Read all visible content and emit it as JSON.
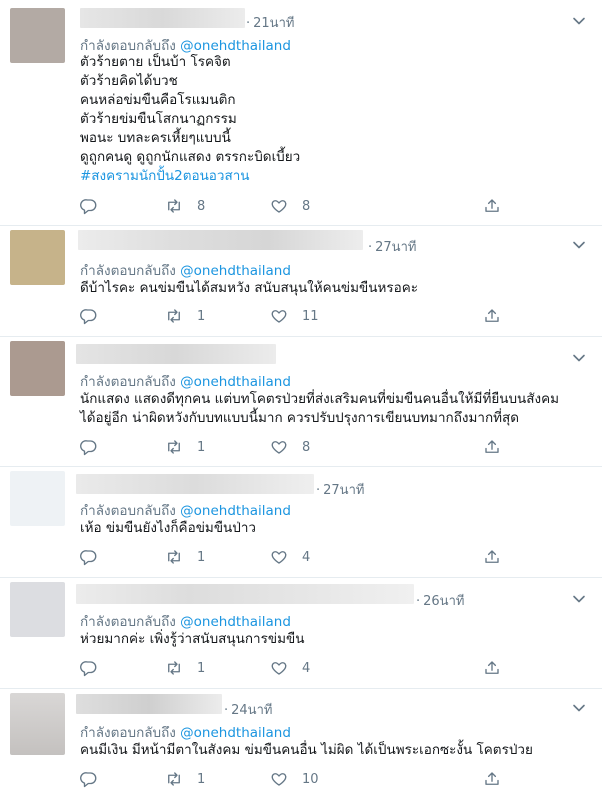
{
  "reply_prefix": "กำลังตอบกลับถึง",
  "handle": "@onehdthailand",
  "tweets": [
    {
      "time": "21นาที",
      "lines": [
        "ตัวร้ายตาย เป็นบ้า โรคจิต",
        "ตัวร้ายคิดได้บวช",
        "คนหล่อข่มขืนคือโรแมนติก",
        "ตัวร้ายข่มขืนโสกนาฏกรรม",
        "พอนะ บทละครเหี้ยๆแบบนี้",
        "ดูถูกคนดู ดูถูกนักแสดง ตรรกะบิดเบี้ยว"
      ],
      "hashtag": "#สงครามนักปั้น2ตอนอวสาน",
      "replies": "",
      "retweets": "8",
      "likes": "8",
      "avatar_color": "#b3aaa4"
    },
    {
      "time": "27นาที",
      "lines": [
        "ดีบ้าไรคะ คนข่มขืนได้สมหวัง สนับสนุนให้คนข่มขืนหรอคะ"
      ],
      "hashtag": "",
      "replies": "",
      "retweets": "1",
      "likes": "11",
      "avatar_color": "#c6b38a"
    },
    {
      "time": "",
      "lines": [
        "นักแสดง แสดงดีทุกคน แต่บทโคตรป่วยที่ส่งเสริมคนที่ข่มขืนคนอื่นให้มีที่ยืนบนสังคม",
        "ได้อยู่อีก น่าผิดหวังกับบทแบบนี้มาก ควรปรับปรุงการเขียนบทมากถึงมากที่สุด"
      ],
      "hashtag": "",
      "replies": "",
      "retweets": "1",
      "likes": "8",
      "avatar_color": "#ab9a90"
    },
    {
      "time": "27นาที",
      "lines": [
        "เห้อ ข่มขืนยังไงก็คือข่มขืนป่าว"
      ],
      "hashtag": "",
      "replies": "",
      "retweets": "1",
      "likes": "4",
      "avatar_color": "#eef2f5"
    },
    {
      "time": "26นาที",
      "lines": [
        "ห่วยมากค่ะ เพิ่งรู้ว่าสนับสนุนการข่มขืน"
      ],
      "hashtag": "",
      "replies": "",
      "retweets": "1",
      "likes": "4",
      "avatar_color": "#dcdde1"
    },
    {
      "time": "24นาที",
      "lines": [
        "คนมีเงิน มีหน้ามีตาในสังคม ข่มขืนคนอื่น ไม่ผิด ได้เป็นพระเอกซะงั้น โคตรป่วย"
      ],
      "hashtag": "",
      "replies": "",
      "retweets": "1",
      "likes": "10",
      "avatar_color": "#c9c6c4"
    }
  ],
  "colors": {
    "link": "#1b95e0",
    "muted": "#657786",
    "border": "#e6ecf0"
  },
  "icons": {
    "reply": "reply-icon",
    "retweet": "retweet-icon",
    "like": "heart-icon",
    "share": "share-icon",
    "menu": "chevron-down-icon"
  }
}
